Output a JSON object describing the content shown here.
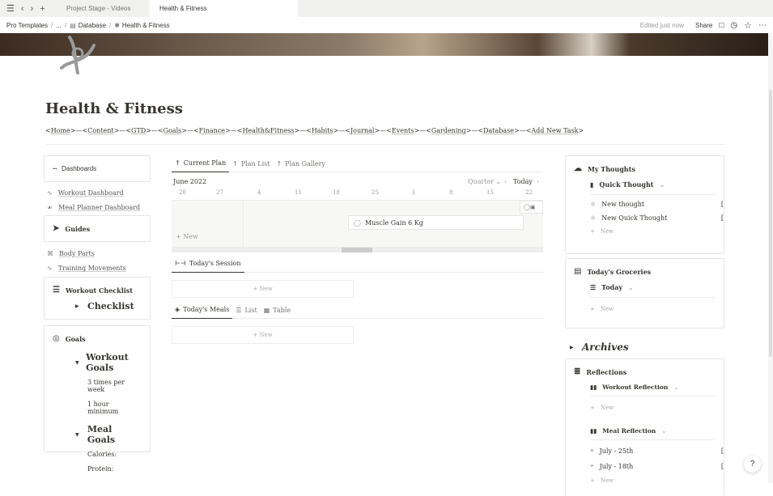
{
  "tabbar": {
    "tab1": "Project Stage - Videos",
    "tab2": "Health & Fitness"
  },
  "breadcrumb": {
    "item1": "Pro Templates",
    "item2": "...",
    "item3": "Database",
    "item4": "Health & Fitness"
  },
  "topbar": {
    "edited": "Edited just now",
    "share": "Share"
  },
  "page": {
    "title": "Health & Fitness"
  },
  "nav_links": [
    "Home",
    "Content",
    "GTD",
    "Goals",
    "Finance",
    "Health&Fitness",
    "Habits",
    "Journal",
    "Events",
    "Gardening",
    "Database",
    "Add New Task"
  ],
  "left": {
    "dashboards": "Dashboards",
    "workout_dashboard": "Workout Dashboard",
    "meal_dashboard": "Meal Planner Dashboard",
    "guides": "Guides",
    "body_parts": "Body Parts",
    "training_movements": "Training Movements",
    "workout_checklist": "Workout Checklist",
    "checklist": "Checklist",
    "goals": "Goals",
    "workout_goals": "Workout Goals",
    "wg1": "3 times per week",
    "wg2": "1 hour minimum",
    "meal_goals": "Meal Goals",
    "mg1": "Calories:",
    "mg2": "Protein:"
  },
  "middle": {
    "tabs": [
      "Current Plan",
      "Plan List",
      "Plan Gallery"
    ],
    "month": "June 2022",
    "range": "Quarter",
    "today": "Today",
    "dates": [
      "20",
      "27",
      "4",
      "11",
      "18",
      "25",
      "1",
      "8",
      "15",
      "22"
    ],
    "event": "Muscle Gain 6 Kg",
    "new": "New",
    "session_tab": "Today's Session",
    "meals_tabs": [
      "Today's Meals",
      "List",
      "Table"
    ]
  },
  "right": {
    "my_thoughts": "My Thoughts",
    "quick_thought": "Quick Thought",
    "t1": "New thought",
    "t2": "New Quick Thought",
    "new": "New",
    "groceries": "Today's Groceries",
    "today": "Today",
    "archives": "Archives",
    "reflections": "Reflections",
    "workout_reflection": "Workout Reflection",
    "meal_reflection": "Meal Reflection",
    "r1": "July - 25th",
    "r2": "July - 18th"
  },
  "help": "?"
}
